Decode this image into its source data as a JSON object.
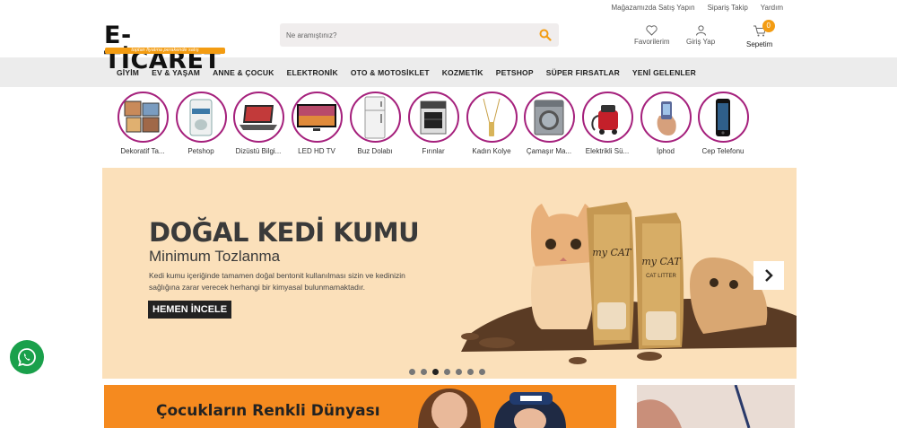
{
  "topbar": {
    "links": [
      "Mağazamızda Satış Yapın",
      "Sipariş Takip",
      "Yardım"
    ]
  },
  "logo": {
    "text": "E-TİCARET",
    "tagline": "toptan fiyatına perakende satış"
  },
  "search": {
    "placeholder": "Ne aramıştınız?",
    "value": ""
  },
  "header": {
    "favorites_label": "Favorilerim",
    "login_label": "Giriş Yap",
    "cart_label": "Sepetim",
    "cart_count": "0"
  },
  "nav": {
    "items": [
      "GİYİM",
      "EV & YAŞAM",
      "ANNE & ÇOCUK",
      "ELEKTRONİK",
      "OTO & MOTOSİKLET",
      "KOZMETİK",
      "PETSHOP",
      "SÜPER FIRSATLAR",
      "YENİ GELENLER"
    ]
  },
  "categories": [
    {
      "label": "Dekoratif Ta...",
      "icon": "frames-icon"
    },
    {
      "label": "Petshop",
      "icon": "pet-food-bag-icon"
    },
    {
      "label": "Dizüstü Bilgi...",
      "icon": "laptop-icon"
    },
    {
      "label": "LED HD TV",
      "icon": "tv-icon"
    },
    {
      "label": "Buz Dolabı",
      "icon": "fridge-icon"
    },
    {
      "label": "Fırınlar",
      "icon": "oven-icon"
    },
    {
      "label": "Kadın Kolye",
      "icon": "necklace-icon"
    },
    {
      "label": "Çamaşır Ma...",
      "icon": "washing-machine-icon"
    },
    {
      "label": "Elektrikli Sü...",
      "icon": "vacuum-icon"
    },
    {
      "label": "İphod",
      "icon": "hand-phone-icon"
    },
    {
      "label": "Cep Telefonu",
      "icon": "smartphone-icon"
    }
  ],
  "banner": {
    "title": "DOĞAL KEDİ KUMU",
    "subtitle": "Minimum Tozlanma",
    "description": "Kedi kumu içeriğinde tamamen doğal bentonit kullanılması sizin ve kedinizin sağlığına zarar verecek herhangi bir kimyasal bulunmamaktadır.",
    "button": "HEMEN İNCELE",
    "product_brand": "my CAT",
    "product_name": "CAT LITTER",
    "slide_count": 7,
    "active_slide": 3
  },
  "promo": {
    "title": "Çocukların Renkli Dünyası"
  },
  "colors": {
    "accent": "#f39c12",
    "category_ring": "#a5207c",
    "banner_bg": "#fbe0ba",
    "whatsapp": "#1aa04b"
  }
}
